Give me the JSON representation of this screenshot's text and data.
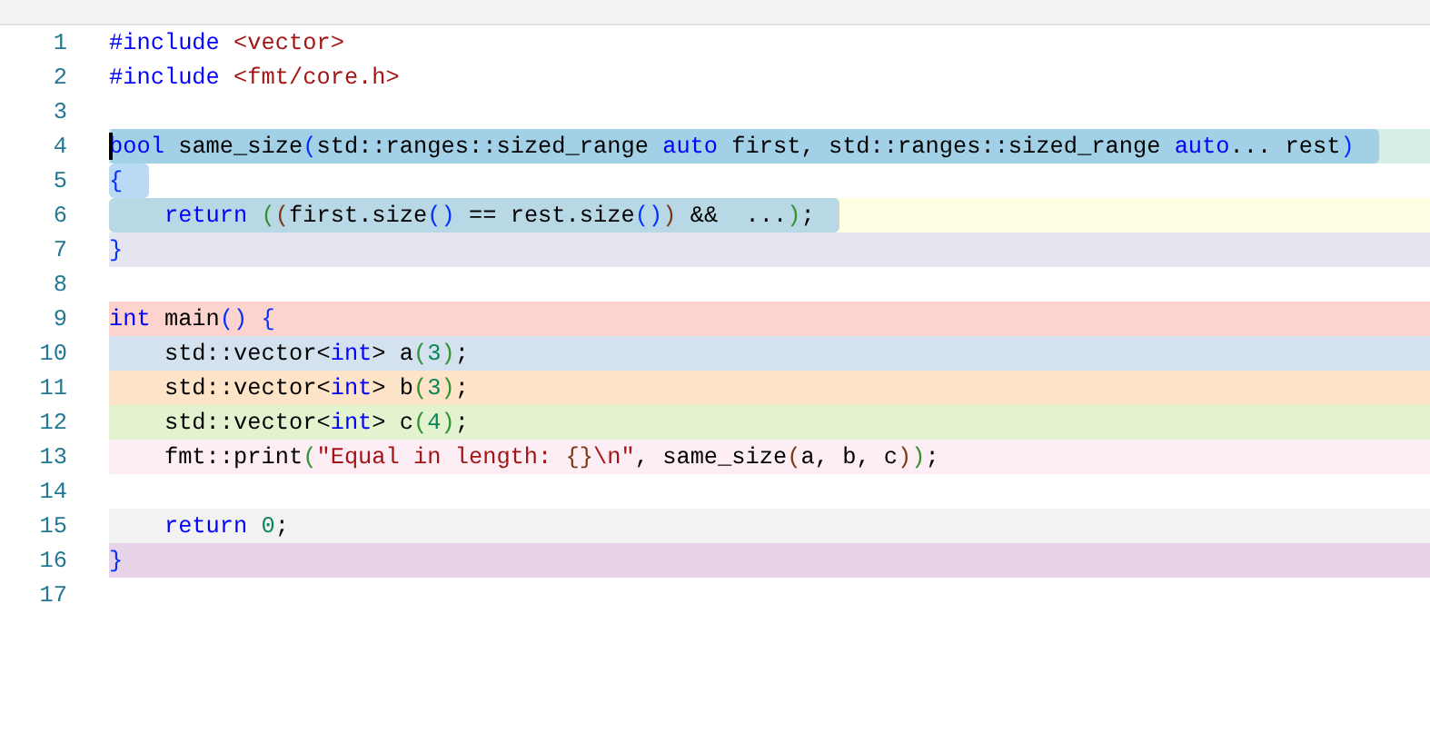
{
  "lines": [
    {
      "number": "1",
      "color": "#ffffff",
      "selected": false,
      "cursor": false,
      "indent": false,
      "tokens": [
        {
          "kind": "pp",
          "text": "#include "
        },
        {
          "kind": "str",
          "text": "<vector>"
        }
      ]
    },
    {
      "number": "2",
      "color": "#ffffff",
      "selected": false,
      "cursor": false,
      "indent": false,
      "tokens": [
        {
          "kind": "pp",
          "text": "#include "
        },
        {
          "kind": "str",
          "text": "<fmt/core.h>"
        }
      ]
    },
    {
      "number": "3"
    },
    {
      "number": "4",
      "color": "#d5eee6",
      "selected": true,
      "cursor": true,
      "indent": false,
      "tokens": [
        {
          "kind": "kw",
          "text": "bool"
        },
        {
          "kind": "txt",
          "text": " same_size"
        },
        {
          "kind": "b1",
          "text": "("
        },
        {
          "kind": "txt",
          "text": "std::ranges::sized_range "
        },
        {
          "kind": "kw",
          "text": "auto"
        },
        {
          "kind": "txt",
          "text": " first, std::ranges::sized_range "
        },
        {
          "kind": "kw",
          "text": "auto"
        },
        {
          "kind": "txt",
          "text": "... rest"
        },
        {
          "kind": "b1",
          "text": ")"
        }
      ]
    },
    {
      "number": "5",
      "color": "#ffffff",
      "selected": true,
      "cursor": false,
      "indent": false,
      "tokens": [
        {
          "kind": "b1",
          "text": "{"
        }
      ]
    },
    {
      "number": "6",
      "color": "#fefee3",
      "selected": true,
      "cursor": false,
      "indent": true,
      "tokens": [
        {
          "kind": "kw",
          "text": "return "
        },
        {
          "kind": "b2",
          "text": "("
        },
        {
          "kind": "b3",
          "text": "("
        },
        {
          "kind": "txt",
          "text": "first.size"
        },
        {
          "kind": "b1",
          "text": "()"
        },
        {
          "kind": "txt",
          "text": " == rest.size"
        },
        {
          "kind": "b1",
          "text": "()"
        },
        {
          "kind": "b3",
          "text": ")"
        },
        {
          "kind": "txt",
          "text": " &&  ..."
        },
        {
          "kind": "b2",
          "text": ")"
        },
        {
          "kind": "txt",
          "text": ";"
        }
      ]
    },
    {
      "number": "7",
      "color": "#e6e6f1",
      "selected": false,
      "cursor": false,
      "indent": false,
      "tokens": [
        {
          "kind": "b1",
          "text": "}"
        }
      ]
    },
    {
      "number": "8"
    },
    {
      "number": "9",
      "color": "#fdd3cd",
      "selected": false,
      "cursor": false,
      "indent": false,
      "tokens": [
        {
          "kind": "kw",
          "text": "int"
        },
        {
          "kind": "txt",
          "text": " main"
        },
        {
          "kind": "b1",
          "text": "()"
        },
        {
          "kind": "b1",
          "text": " {"
        }
      ]
    },
    {
      "number": "10",
      "color": "#d3e2ee",
      "selected": false,
      "cursor": false,
      "indent": true,
      "tokens": [
        {
          "kind": "txt",
          "text": "std::vector<"
        },
        {
          "kind": "kw",
          "text": "int"
        },
        {
          "kind": "txt",
          "text": "> a"
        },
        {
          "kind": "b2",
          "text": "("
        },
        {
          "kind": "num",
          "text": "3"
        },
        {
          "kind": "b2",
          "text": ")"
        },
        {
          "kind": "txt",
          "text": ";"
        }
      ]
    },
    {
      "number": "11",
      "color": "#fde3c8",
      "selected": false,
      "cursor": false,
      "indent": true,
      "tokens": [
        {
          "kind": "txt",
          "text": "std::vector<"
        },
        {
          "kind": "kw",
          "text": "int"
        },
        {
          "kind": "txt",
          "text": "> b"
        },
        {
          "kind": "b2",
          "text": "("
        },
        {
          "kind": "num",
          "text": "3"
        },
        {
          "kind": "b2",
          "text": ")"
        },
        {
          "kind": "txt",
          "text": ";"
        }
      ]
    },
    {
      "number": "12",
      "color": "#e3f2cf",
      "selected": false,
      "cursor": false,
      "indent": true,
      "tokens": [
        {
          "kind": "txt",
          "text": "std::vector<"
        },
        {
          "kind": "kw",
          "text": "int"
        },
        {
          "kind": "txt",
          "text": "> c"
        },
        {
          "kind": "b2",
          "text": "("
        },
        {
          "kind": "num",
          "text": "4"
        },
        {
          "kind": "b2",
          "text": ")"
        },
        {
          "kind": "txt",
          "text": ";"
        }
      ]
    },
    {
      "number": "13",
      "color": "#fdeef5",
      "selected": false,
      "cursor": false,
      "indent": true,
      "tokens": [
        {
          "kind": "txt",
          "text": "fmt::print"
        },
        {
          "kind": "b2",
          "text": "("
        },
        {
          "kind": "str",
          "text": "\"Equal in length: "
        },
        {
          "kind": "b3",
          "text": "{}"
        },
        {
          "kind": "str",
          "text": "\\n\""
        },
        {
          "kind": "txt",
          "text": ", same_size"
        },
        {
          "kind": "b3",
          "text": "("
        },
        {
          "kind": "txt",
          "text": "a, b, c"
        },
        {
          "kind": "b3",
          "text": ")"
        },
        {
          "kind": "b2",
          "text": ")"
        },
        {
          "kind": "txt",
          "text": ";"
        }
      ]
    },
    {
      "number": "14"
    },
    {
      "number": "15",
      "color": "#f2f2f2",
      "selected": false,
      "cursor": false,
      "indent": true,
      "tokens": [
        {
          "kind": "kw",
          "text": "return "
        },
        {
          "kind": "num",
          "text": "0"
        },
        {
          "kind": "txt",
          "text": ";"
        }
      ]
    },
    {
      "number": "16",
      "color": "#e8d4e8",
      "selected": false,
      "cursor": false,
      "indent": false,
      "tokens": [
        {
          "kind": "b1",
          "text": "}"
        }
      ]
    },
    {
      "number": "17"
    }
  ]
}
